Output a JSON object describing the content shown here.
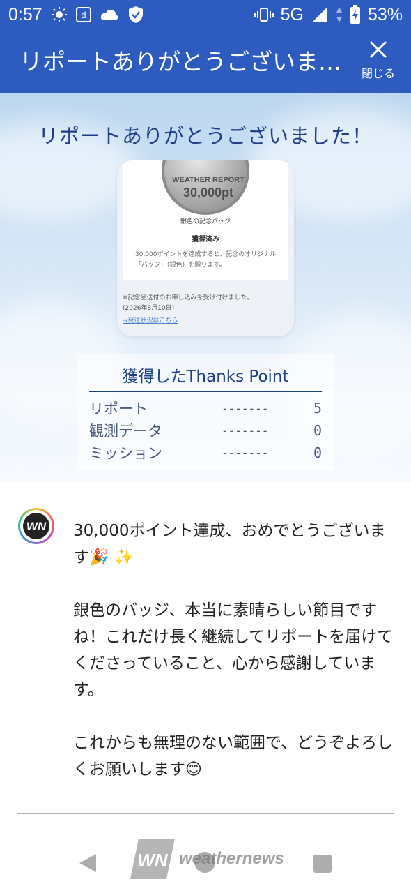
{
  "status_bar": {
    "time": "0:57",
    "network": "5G",
    "battery": "53%",
    "icons": [
      "sun-icon",
      "d-app-icon",
      "cloud-icon",
      "shield-check-icon",
      "vibrate-icon",
      "signal-icon",
      "data-arrows-icon",
      "battery-charging-icon"
    ]
  },
  "app_bar": {
    "title": "リポートありがとうございま…",
    "close_label": "閉じる"
  },
  "hero": {
    "title": "リポートありがとうございました！"
  },
  "badge": {
    "medal_line1": "WEATHER REPORT",
    "medal_line2": "30,000pt",
    "name": "銀色の記念バッジ",
    "status": "獲得済み",
    "description": "30,000ポイントを達成すると、記念のオリジナル「バッジ」（銀色）を贈ります。",
    "note_line1": "※記念品送付のお申し込みを受け付けました。",
    "note_line2": "(2026年8月10日)",
    "link": "→発送状況はこちら"
  },
  "points": {
    "title": "獲得したThanks Point",
    "rows": [
      {
        "label": "リポート",
        "dash": "-------",
        "value": "5"
      },
      {
        "label": "観測データ",
        "dash": "-------",
        "value": "0"
      },
      {
        "label": "ミッション",
        "dash": "-------",
        "value": "0"
      }
    ]
  },
  "message": {
    "avatar_text": "WN",
    "paragraph1": "30,000ポイント達成、おめでとうございます🎉 ✨",
    "paragraph2": "銀色のバッジ、本当に素晴らしい節目ですね！これだけ長く継続してリポートを届けてくださっていること、心から感謝しています。",
    "paragraph3": "これからも無理のない範囲で、どうぞよろしくお願いします😊"
  },
  "footer": {
    "logo_mark": "WN",
    "brand": "weathernews"
  },
  "colors": {
    "primary": "#2d5bbf",
    "title_navy": "#1f3e87"
  }
}
